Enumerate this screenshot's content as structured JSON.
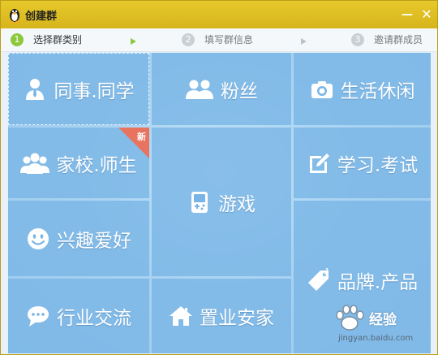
{
  "window": {
    "title": "创建群",
    "minimize_glyph": "—",
    "close_glyph": "✕"
  },
  "steps": [
    {
      "number": "1",
      "label": "选择群类别",
      "state": "active"
    },
    {
      "number": "2",
      "label": "填写群信息",
      "state": "inactive"
    },
    {
      "number": "3",
      "label": "邀请群成员",
      "state": "inactive"
    }
  ],
  "tiles": {
    "coworker": {
      "label": "同事.同学",
      "icon": "person-tie-icon"
    },
    "fans": {
      "label": "粉丝",
      "icon": "two-people-icon"
    },
    "life": {
      "label": "生活休闲",
      "icon": "camera-icon"
    },
    "school": {
      "label": "家校.师生",
      "icon": "three-people-icon",
      "badge": "新"
    },
    "game": {
      "label": "游戏",
      "icon": "gameboy-icon"
    },
    "study": {
      "label": "学习.考试",
      "icon": "pencil-box-icon"
    },
    "hobby": {
      "label": "兴趣爱好",
      "icon": "smiley-icon"
    },
    "brand": {
      "label": "品牌.产品",
      "icon": "tag-icon"
    },
    "industry": {
      "label": "行业交流",
      "icon": "chat-bubble-icon"
    },
    "estate": {
      "label": "置业安家",
      "icon": "house-icon"
    }
  },
  "watermark": {
    "text": "经验",
    "url": "jingyan.baidu.com"
  },
  "colors": {
    "titlebar": "#dcbc22",
    "tile": "#78b5e6",
    "badge": "#e8735e",
    "step_active": "#8cc83b"
  }
}
